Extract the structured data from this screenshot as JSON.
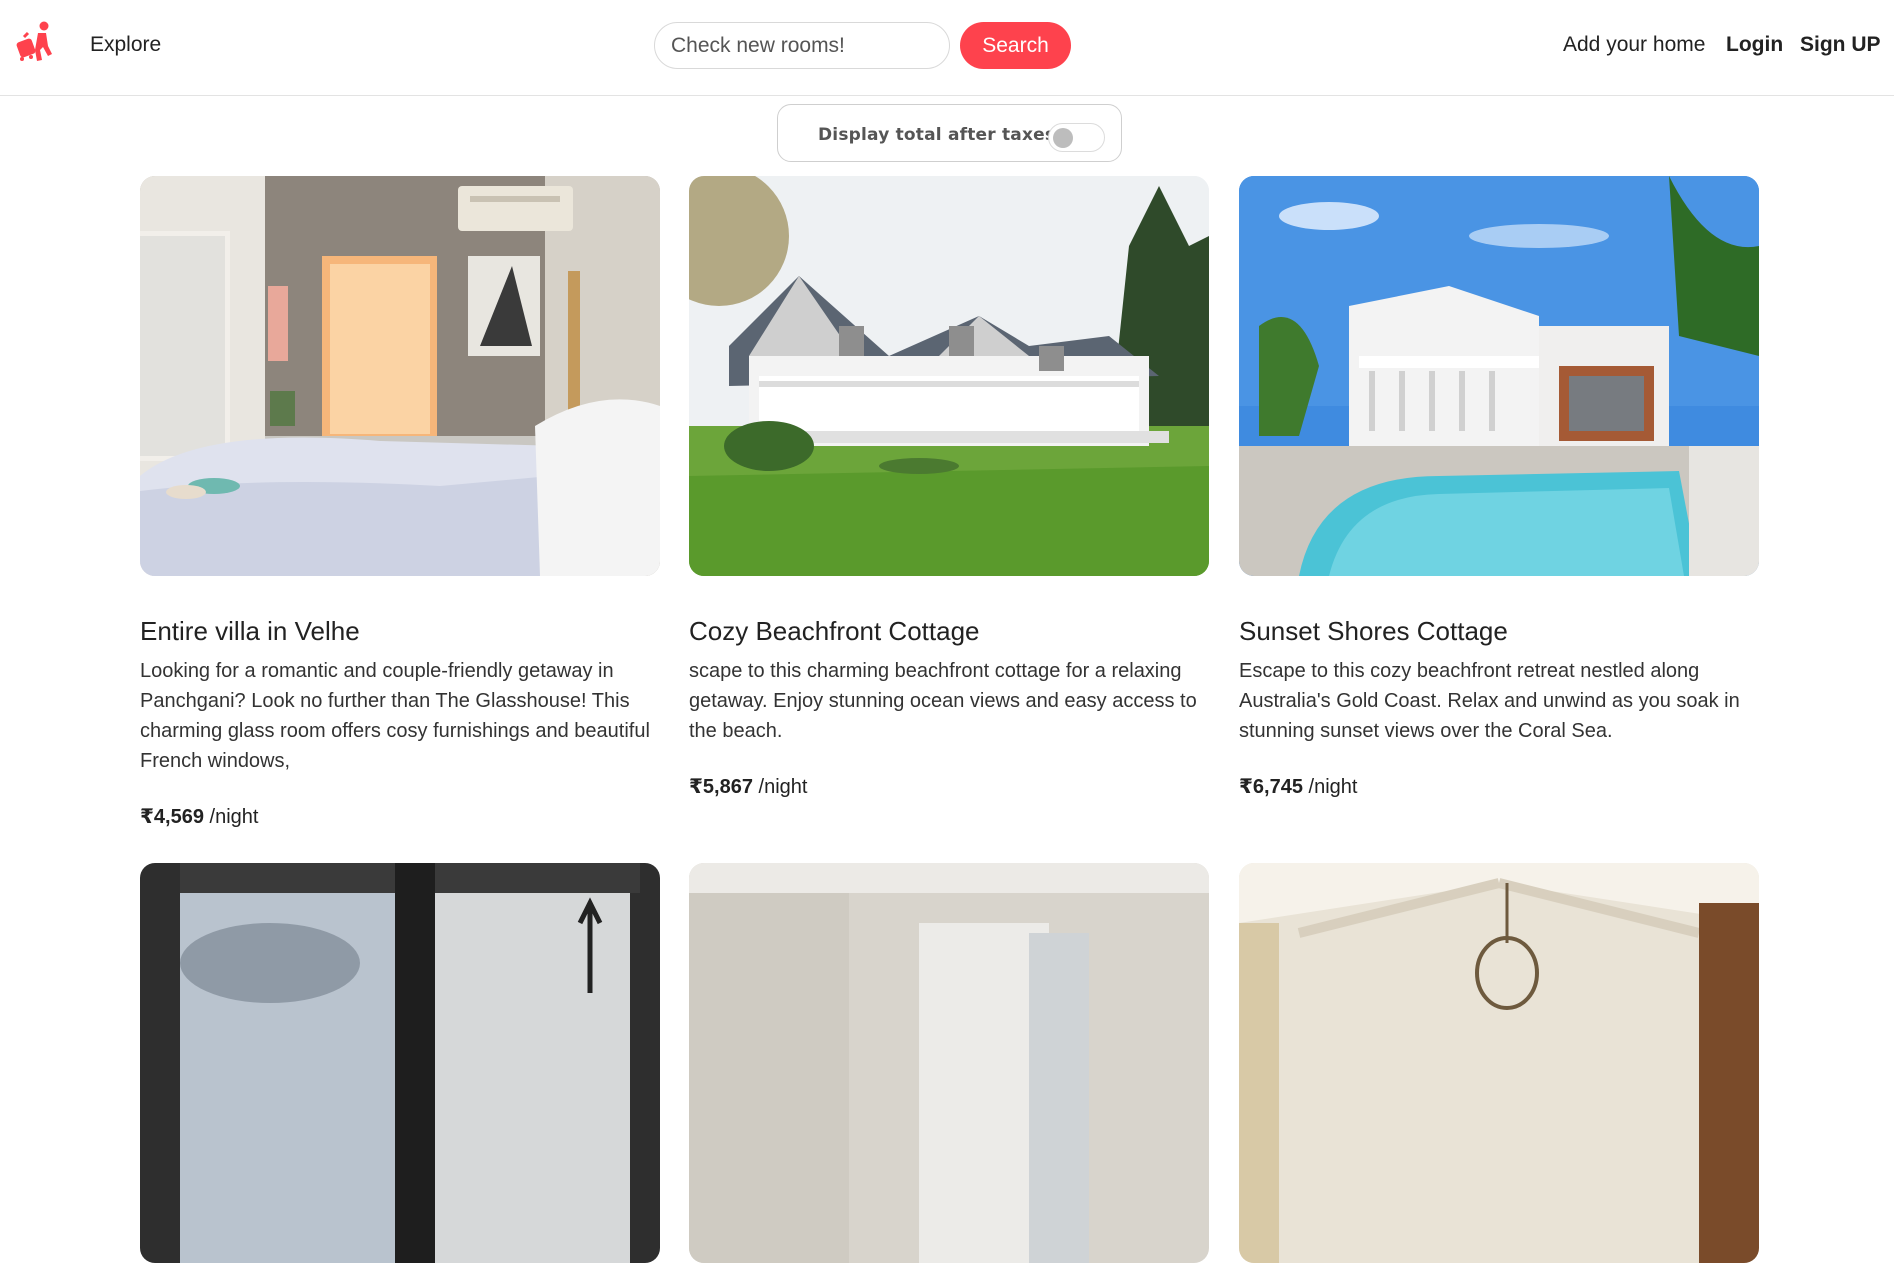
{
  "nav": {
    "explore": "Explore",
    "search_placeholder": "Check new rooms!",
    "search_button": "Search",
    "add_home": "Add your home",
    "login": "Login",
    "signup": "Sign UP"
  },
  "tax_toggle": {
    "label": "Display total after taxes",
    "checked": false
  },
  "colors": {
    "brand": "#fe424d",
    "border": "#e3e3e3"
  },
  "listings": [
    {
      "title": "Entire villa in Velhe",
      "description": "Looking for a romantic and couple-friendly getaway in Panchgani? Look no further than The Glasshouse! This charming glass room offers cosy furnishings and beautiful French windows,",
      "price": "₹4,569",
      "unit": " /night",
      "image": "bedroom-with-orange-curtains"
    },
    {
      "title": "Cozy Beachfront Cottage",
      "description": "scape to this charming beachfront cottage for a relaxing getaway. Enjoy stunning ocean views and easy access to the beach.",
      "price": "₹5,867",
      "unit": " /night",
      "image": "white-cottage-with-lawn"
    },
    {
      "title": "Sunset Shores Cottage",
      "description": "Escape to this cozy beachfront retreat nestled along Australia's Gold Coast. Relax and unwind as you soak in stunning sunset views over the Coral Sea.",
      "price": "₹6,745",
      "unit": " /night",
      "image": "house-with-pool-and-palms"
    },
    {
      "image": "window-room-with-coat-rack"
    },
    {
      "image": "bright-room-with-curtains"
    },
    {
      "image": "vaulted-ceiling-with-chandelier"
    }
  ]
}
